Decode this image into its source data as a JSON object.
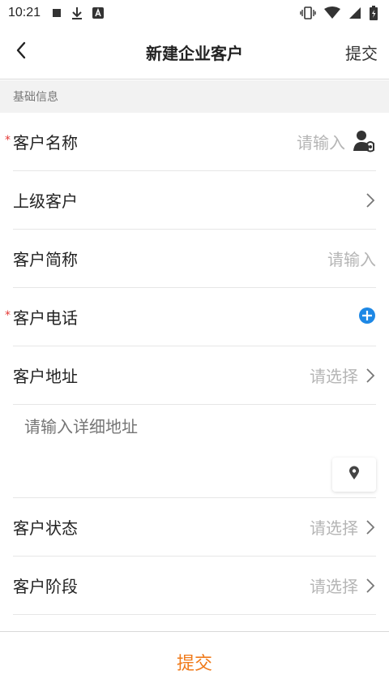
{
  "status_bar": {
    "time": "10:21",
    "left_icons": [
      "stop-square-icon",
      "download-icon",
      "text-a-icon"
    ],
    "right_icons": [
      "vibrate-icon",
      "wifi-icon",
      "signal-icon",
      "battery-icon"
    ]
  },
  "nav": {
    "title": "新建企业客户",
    "submit_label": "提交"
  },
  "section": {
    "title": "基础信息"
  },
  "form": {
    "customer_name": {
      "label": "客户名称",
      "required": "*",
      "placeholder": "请输入"
    },
    "parent_customer": {
      "label": "上级客户"
    },
    "short_name": {
      "label": "客户简称",
      "placeholder": "请输入"
    },
    "phone": {
      "label": "客户电话",
      "required": "*"
    },
    "address": {
      "label": "客户地址",
      "placeholder": "请选择"
    },
    "address_detail": {
      "placeholder": "请输入详细地址"
    },
    "status": {
      "label": "客户状态",
      "placeholder": "请选择"
    },
    "stage": {
      "label": "客户阶段",
      "placeholder": "请选择"
    }
  },
  "bottom": {
    "submit_label": "提交"
  },
  "colors": {
    "accent_orange": "#f07a1a",
    "add_blue": "#1e88e5",
    "required_red": "#e53935",
    "placeholder_gray": "#b5b5b5"
  }
}
